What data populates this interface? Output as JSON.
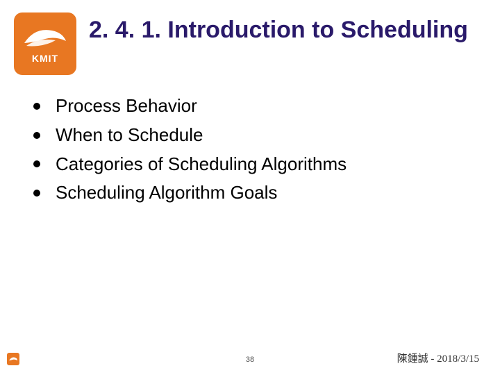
{
  "logo": {
    "text": "KMIT"
  },
  "title": "2. 4. 1. Introduction to Scheduling",
  "bullets": [
    "Process Behavior",
    "When to Schedule",
    "Categories of Scheduling Algorithms",
    "Scheduling Algorithm Goals"
  ],
  "footer": {
    "page": "38",
    "author_date": "陳鍾誠 - 2018/3/15"
  }
}
